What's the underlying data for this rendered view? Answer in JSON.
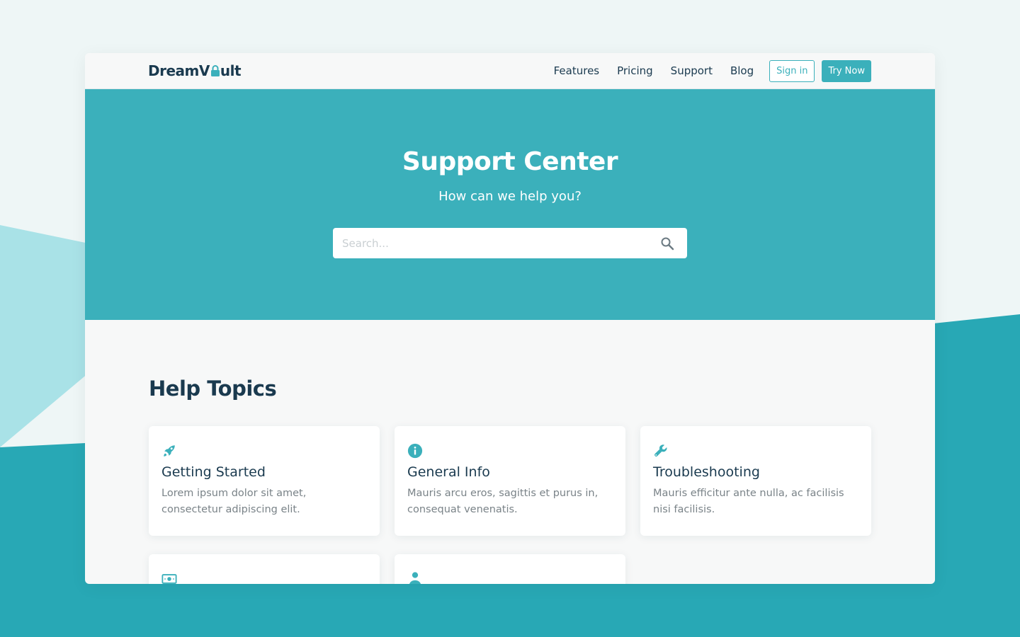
{
  "brand": {
    "name_prefix": "DreamV",
    "name_suffix": "ult",
    "accent": "#3bb0bb",
    "dark": "#1a3a4f"
  },
  "nav": {
    "links": [
      "Features",
      "Pricing",
      "Support",
      "Blog"
    ],
    "sign_in": "Sign in",
    "try_now": "Try Now"
  },
  "hero": {
    "title": "Support Center",
    "subtitle": "How can we help you?",
    "search_placeholder": "Search..."
  },
  "help": {
    "title": "Help Topics",
    "cards": [
      {
        "icon": "rocket-icon",
        "title": "Getting Started",
        "text": "Lorem ipsum dolor sit amet, consectetur adipiscing elit."
      },
      {
        "icon": "info-icon",
        "title": "General Info",
        "text": "Mauris arcu eros, sagittis et purus in, consequat venenatis."
      },
      {
        "icon": "wrench-icon",
        "title": "Troubleshooting",
        "text": "Mauris efficitur ante nulla, ac facilisis nisi facilisis."
      },
      {
        "icon": "money-icon",
        "title": "",
        "text": ""
      },
      {
        "icon": "user-icon",
        "title": "",
        "text": ""
      }
    ]
  }
}
